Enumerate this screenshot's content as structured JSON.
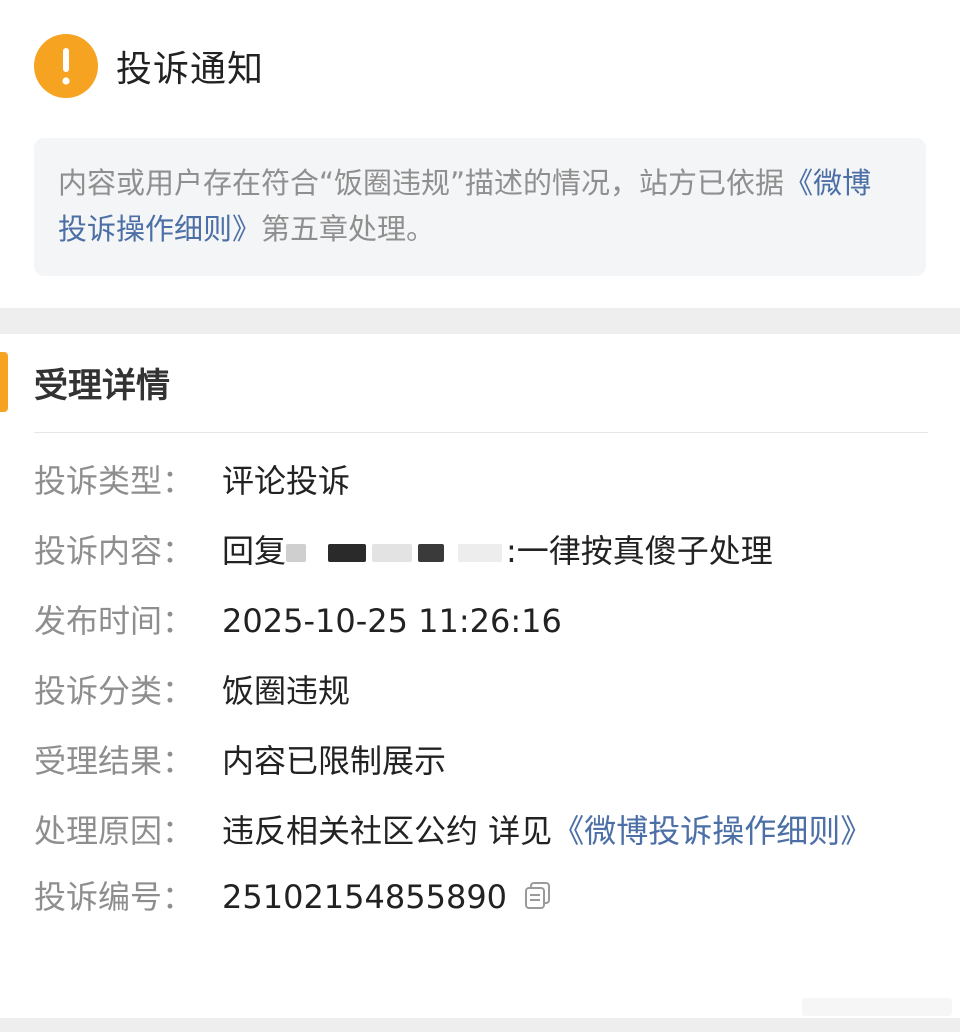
{
  "notice": {
    "icon": "exclamation-icon",
    "title": "投诉通知",
    "accent_color": "#f7a322"
  },
  "description": {
    "text_before": "内容或用户存在符合“饭圈违规”描述的情况，站方已依据",
    "link_text": "《微博投诉操作细则》",
    "text_after": "第五章处理。"
  },
  "details": {
    "section_title": "受理详情",
    "complaint_type": {
      "label": "投诉类型：",
      "value": "评论投诉"
    },
    "complaint_content": {
      "label": "投诉内容：",
      "prefix": "回复",
      "suffix": ":一律按真傻子处理"
    },
    "publish_time": {
      "label": "发布时间：",
      "value": "2025-10-25 11:26:16"
    },
    "category": {
      "label": "投诉分类：",
      "value": "饭圈违规"
    },
    "result": {
      "label": "受理结果：",
      "value": "内容已限制展示"
    },
    "reason": {
      "label": "处理原因：",
      "text": "违反相关社区公约 详见",
      "link_text": "《微博投诉操作细则》"
    },
    "complaint_id": {
      "label": "投诉编号：",
      "value": "25102154855890",
      "copy_icon": "copy-icon"
    }
  },
  "colors": {
    "link": "#4c6fa6",
    "label": "#8e8e8e",
    "value": "#222222",
    "desc_bg": "#f4f5f6"
  }
}
